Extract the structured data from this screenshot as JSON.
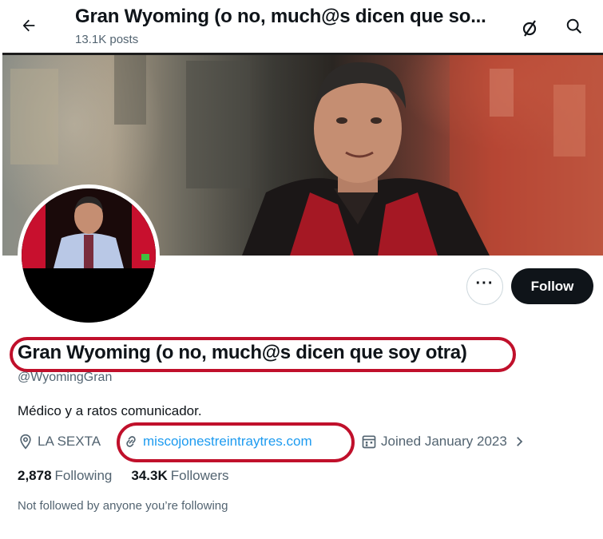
{
  "header": {
    "title": "Gran Wyoming (o no, much@s dicen que so...",
    "posts_count": "13.1K posts",
    "back_icon": "arrow-left-icon",
    "hide_icon": "null-set-icon",
    "search_icon": "search-icon"
  },
  "profile": {
    "name": "Gran Wyoming (o no, much@s dicen que soy otra)",
    "handle": "@WyomingGran",
    "bio": "Médico y a ratos comunicador.",
    "location": "LA SEXTA",
    "website": "miscojonestreintraytres.com",
    "joined": "Joined January 2023",
    "following_count": "2,878",
    "following_label": "Following",
    "followers_count": "34.3K",
    "followers_label": "Followers",
    "not_followed_text": "Not followed by anyone you’re following"
  },
  "actions": {
    "more_label": "···",
    "follow_label": "Follow"
  },
  "colors": {
    "link": "#1d9bf0",
    "highlight_ring": "#c0102b",
    "text_primary": "#0f1419",
    "text_secondary": "#536471"
  }
}
